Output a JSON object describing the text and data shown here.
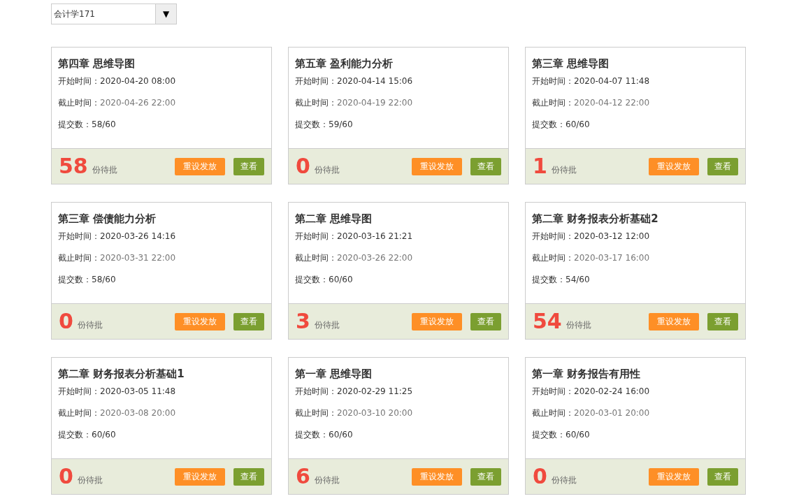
{
  "class_select": {
    "value": "会计学171",
    "arrow": "▼"
  },
  "cards": [
    {
      "title": "第四章 思维导图",
      "start_label": "开始时间：",
      "start": "2020-04-20 08:00",
      "end_label": "截止时间：",
      "end": "2020-04-26 22:00",
      "submit_label": "提交数：",
      "submitted": "58/60",
      "pending": "58",
      "pending_label": "份待批",
      "reset": "重设发放",
      "view": "查看"
    },
    {
      "title": "第五章 盈利能力分析",
      "start_label": "开始时间：",
      "start": "2020-04-14 15:06",
      "end_label": "截止时间：",
      "end": "2020-04-19 22:00",
      "submit_label": "提交数：",
      "submitted": "59/60",
      "pending": "0",
      "pending_label": "份待批",
      "reset": "重设发放",
      "view": "查看"
    },
    {
      "title": "第三章 思维导图",
      "start_label": "开始时间：",
      "start": "2020-04-07 11:48",
      "end_label": "截止时间：",
      "end": "2020-04-12 22:00",
      "submit_label": "提交数：",
      "submitted": "60/60",
      "pending": "1",
      "pending_label": "份待批",
      "reset": "重设发放",
      "view": "查看"
    },
    {
      "title": "第三章 偿债能力分析",
      "start_label": "开始时间：",
      "start": "2020-03-26 14:16",
      "end_label": "截止时间：",
      "end": "2020-03-31 22:00",
      "submit_label": "提交数：",
      "submitted": "58/60",
      "pending": "0",
      "pending_label": "份待批",
      "reset": "重设发放",
      "view": "查看"
    },
    {
      "title": "第二章 思维导图",
      "start_label": "开始时间：",
      "start": "2020-03-16 21:21",
      "end_label": "截止时间：",
      "end": "2020-03-26 22:00",
      "submit_label": "提交数：",
      "submitted": "60/60",
      "pending": "3",
      "pending_label": "份待批",
      "reset": "重设发放",
      "view": "查看"
    },
    {
      "title": "第二章 财务报表分析基础2",
      "start_label": "开始时间：",
      "start": "2020-03-12 12:00",
      "end_label": "截止时间：",
      "end": "2020-03-17 16:00",
      "submit_label": "提交数：",
      "submitted": "54/60",
      "pending": "54",
      "pending_label": "份待批",
      "reset": "重设发放",
      "view": "查看"
    },
    {
      "title": "第二章 财务报表分析基础1",
      "start_label": "开始时间：",
      "start": "2020-03-05 11:48",
      "end_label": "截止时间：",
      "end": "2020-03-08 20:00",
      "submit_label": "提交数：",
      "submitted": "60/60",
      "pending": "0",
      "pending_label": "份待批",
      "reset": "重设发放",
      "view": "查看"
    },
    {
      "title": "第一章 思维导图",
      "start_label": "开始时间：",
      "start": "2020-02-29 11:25",
      "end_label": "截止时间：",
      "end": "2020-03-10 20:00",
      "submit_label": "提交数：",
      "submitted": "60/60",
      "pending": "6",
      "pending_label": "份待批",
      "reset": "重设发放",
      "view": "查看"
    },
    {
      "title": "第一章 财务报告有用性",
      "start_label": "开始时间：",
      "start": "2020-02-24 16:00",
      "end_label": "截止时间：",
      "end": "2020-03-01 20:00",
      "submit_label": "提交数：",
      "submitted": "60/60",
      "pending": "0",
      "pending_label": "份待批",
      "reset": "重设发放",
      "view": "查看"
    }
  ]
}
